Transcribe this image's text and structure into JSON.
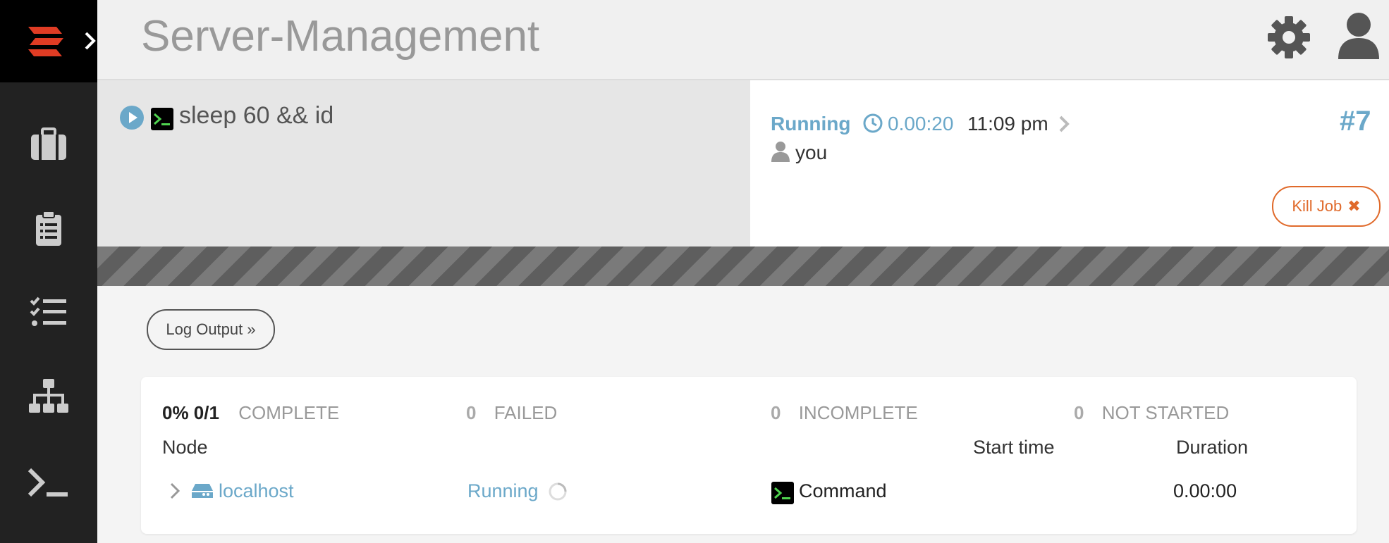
{
  "app": {
    "title": "Server-Management"
  },
  "colors": {
    "accent": "#6ba8c9",
    "danger": "#e06a2b",
    "sidebar": "#222222"
  },
  "sidebar": {
    "items": [
      {
        "icon": "briefcase-icon"
      },
      {
        "icon": "clipboard-icon"
      },
      {
        "icon": "checklist-icon"
      },
      {
        "icon": "sitemap-icon"
      },
      {
        "icon": "terminal-icon"
      }
    ]
  },
  "header": {
    "settings_icon": "gear-icon",
    "user_icon": "user-icon"
  },
  "job": {
    "command": "sleep 60 && id",
    "status": "Running",
    "duration": "0.00:20",
    "time": "11:09 pm",
    "user": "you",
    "number": "#7",
    "kill_label": "Kill Job",
    "kill_symbol": "✖"
  },
  "log_output_label": "Log Output »",
  "summary": {
    "percent": "0% 0/1",
    "complete_label": "COMPLETE",
    "failed_count": "0",
    "failed_label": "FAILED",
    "incomplete_count": "0",
    "incomplete_label": "INCOMPLETE",
    "not_started_count": "0",
    "not_started_label": "NOT STARTED"
  },
  "table": {
    "headers": {
      "node": "Node",
      "start_time": "Start time",
      "duration": "Duration"
    },
    "rows": [
      {
        "node": "localhost",
        "status": "Running",
        "step": "Command",
        "start_time": "",
        "duration": "0.00:00"
      }
    ]
  }
}
